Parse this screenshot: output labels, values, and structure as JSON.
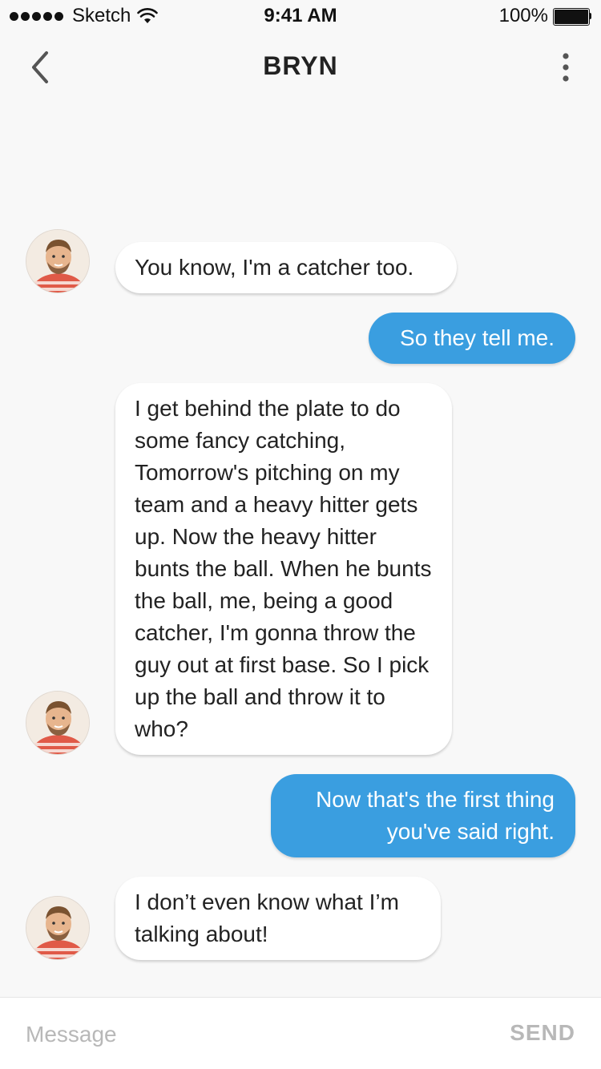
{
  "status_bar": {
    "carrier": "Sketch",
    "time": "9:41 AM",
    "battery": "100%",
    "signal_icon": "signal-dots-icon",
    "wifi_icon": "wifi-icon",
    "battery_icon": "battery-icon"
  },
  "nav": {
    "title": "BRYN",
    "back_icon": "chevron-left-icon",
    "more_icon": "more-vertical-icon"
  },
  "messages": [
    {
      "direction": "in",
      "text": "You know, I'm a catcher too."
    },
    {
      "direction": "out",
      "text": "So they tell me."
    },
    {
      "direction": "in",
      "text": "I get behind the plate to do some fancy catching, Tomorrow's pitching on my team and a heavy hitter gets up. Now the heavy hitter bunts the ball. When he bunts the ball, me, being a good catcher, I'm gonna throw the guy out at first base. So I pick up the ball and throw it to who?"
    },
    {
      "direction": "out",
      "text": "Now that's the first thing you've said right."
    },
    {
      "direction": "in",
      "text": "I don’t even know what I’m talking about!"
    }
  ],
  "composer": {
    "placeholder": "Message",
    "send_label": "SEND"
  },
  "colors": {
    "outgoing_bubble": "#3a9ee0",
    "incoming_bubble": "#ffffff",
    "background": "#f8f8f8",
    "muted": "#b8b8b8"
  }
}
